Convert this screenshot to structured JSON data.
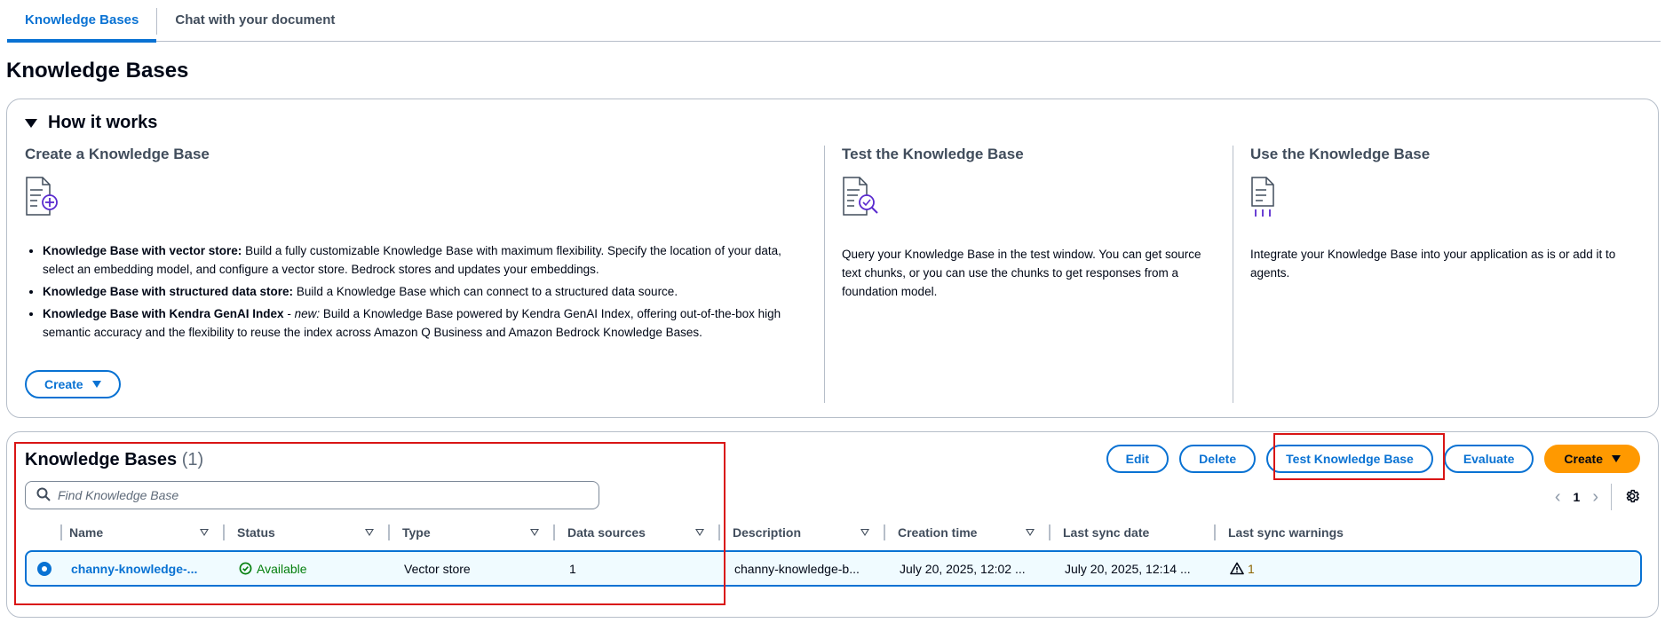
{
  "tabs": [
    {
      "label": "Knowledge Bases"
    },
    {
      "label": "Chat with your document"
    }
  ],
  "page_title": "Knowledge Bases",
  "how_it_works": {
    "header": "How it works",
    "create": {
      "title": "Create a Knowledge Base",
      "icon": "document-plus-icon",
      "bullets": [
        {
          "bold": "Knowledge Base with vector store:",
          "text": " Build a fully customizable Knowledge Base with maximum flexibility. Specify the location of your data, select an embedding model, and configure a vector store. Bedrock stores and updates your embeddings."
        },
        {
          "bold": "Knowledge Base with structured data store:",
          "text": " Build a Knowledge Base which can connect to a structured data source."
        },
        {
          "bold": "Knowledge Base with Kendra GenAI Index",
          "em": "new:",
          "text": " Build a Knowledge Base powered by Kendra GenAI Index, offering out-of-the-box high semantic accuracy and the flexibility to reuse the index across Amazon Q Business and Amazon Bedrock Knowledge Bases."
        }
      ],
      "button": "Create"
    },
    "test": {
      "title": "Test the Knowledge Base",
      "icon": "document-search-icon",
      "text": "Query your Knowledge Base in the test window. You can get source text chunks, or you can use the chunks to get responses from a foundation model."
    },
    "use": {
      "title": "Use the Knowledge Base",
      "icon": "document-integrate-icon",
      "text": "Integrate your Knowledge Base into your application as is or add it to agents."
    }
  },
  "kb_table": {
    "title": "Knowledge Bases",
    "count": "(1)",
    "actions": {
      "edit": "Edit",
      "delete": "Delete",
      "test": "Test Knowledge Base",
      "evaluate": "Evaluate",
      "create": "Create"
    },
    "search_placeholder": "Find Knowledge Base",
    "page": "1",
    "columns": [
      "Name",
      "Status",
      "Type",
      "Data sources",
      "Description",
      "Creation time",
      "Last sync date",
      "Last sync warnings"
    ],
    "rows": [
      {
        "name": "channy-knowledge-...",
        "status": "Available",
        "type": "Vector store",
        "data_sources": "1",
        "description": "channy-knowledge-b...",
        "creation_time": "July 20, 2025, 12:02 ...",
        "last_sync_date": "July 20, 2025, 12:14 ...",
        "warnings": "1"
      }
    ]
  },
  "colors": {
    "accent": "#0972d3",
    "primary_button": "#ff9900",
    "success": "#037f0c",
    "warning": "#8d6605",
    "highlight": "#d91515"
  }
}
